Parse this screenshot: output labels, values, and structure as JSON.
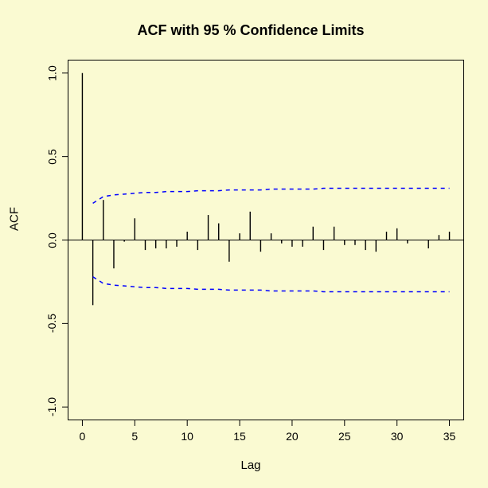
{
  "chart_data": {
    "type": "bar",
    "title": "ACF with 95 % Confidence Limits",
    "xlabel": "Lag",
    "ylabel": "ACF",
    "xlim": [
      0,
      35
    ],
    "ylim": [
      -1.0,
      1.0
    ],
    "xticks": [
      0,
      5,
      10,
      15,
      20,
      25,
      30,
      35
    ],
    "yticks": [
      -1.0,
      -0.5,
      0.0,
      0.5,
      1.0
    ],
    "xtick_labels": [
      "0",
      "5",
      "10",
      "15",
      "20",
      "25",
      "30",
      "35"
    ],
    "ytick_labels": [
      "-1.0",
      "-0.5",
      "0.0",
      "0.5",
      "1.0"
    ],
    "lags": [
      0,
      1,
      2,
      3,
      4,
      5,
      6,
      7,
      8,
      9,
      10,
      11,
      12,
      13,
      14,
      15,
      16,
      17,
      18,
      19,
      20,
      21,
      22,
      23,
      24,
      25,
      26,
      27,
      28,
      29,
      30,
      31,
      32,
      33,
      34,
      35
    ],
    "acf": [
      1.0,
      -0.39,
      0.24,
      -0.17,
      -0.01,
      0.13,
      -0.06,
      -0.05,
      -0.05,
      -0.04,
      0.05,
      -0.06,
      0.15,
      0.1,
      -0.13,
      0.04,
      0.17,
      -0.07,
      0.04,
      -0.02,
      -0.04,
      -0.04,
      0.08,
      -0.06,
      0.08,
      -0.03,
      -0.03,
      -0.06,
      -0.07,
      0.05,
      0.07,
      -0.02,
      0.0,
      -0.05,
      0.03,
      0.05
    ],
    "conf_upper": [
      0.22,
      0.26,
      0.27,
      0.275,
      0.28,
      0.285,
      0.285,
      0.29,
      0.29,
      0.29,
      0.295,
      0.295,
      0.295,
      0.3,
      0.3,
      0.3,
      0.3,
      0.305,
      0.305,
      0.305,
      0.305,
      0.305,
      0.31,
      0.31,
      0.31,
      0.31,
      0.31,
      0.31,
      0.31,
      0.31,
      0.31,
      0.31,
      0.31,
      0.31,
      0.31
    ],
    "conf_lower": [
      -0.22,
      -0.26,
      -0.27,
      -0.275,
      -0.28,
      -0.285,
      -0.285,
      -0.29,
      -0.29,
      -0.29,
      -0.295,
      -0.295,
      -0.295,
      -0.3,
      -0.3,
      -0.3,
      -0.3,
      -0.305,
      -0.305,
      -0.305,
      -0.305,
      -0.305,
      -0.31,
      -0.31,
      -0.31,
      -0.31,
      -0.31,
      -0.31,
      -0.31,
      -0.31,
      -0.31,
      -0.31,
      -0.31,
      -0.31,
      -0.31
    ],
    "colors": {
      "conf_line": "#0000ff",
      "bar": "#000000",
      "axis": "#000000",
      "bg": "#fafad2"
    }
  }
}
